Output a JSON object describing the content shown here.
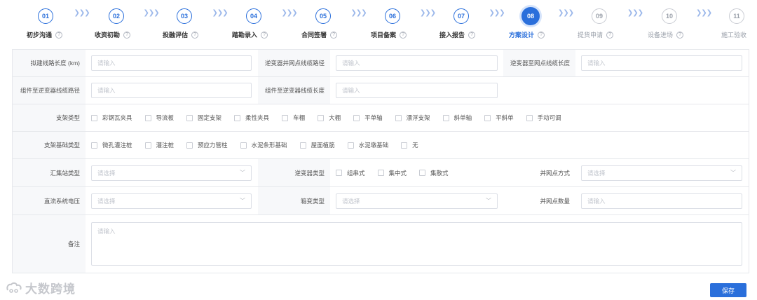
{
  "stepper": {
    "steps": [
      {
        "num": "01",
        "label": "初步沟通"
      },
      {
        "num": "02",
        "label": "收资初勘"
      },
      {
        "num": "03",
        "label": "投融评估"
      },
      {
        "num": "04",
        "label": "踏勘录入"
      },
      {
        "num": "05",
        "label": "合同签署"
      },
      {
        "num": "06",
        "label": "项目备案"
      },
      {
        "num": "07",
        "label": "接入报告"
      },
      {
        "num": "08",
        "label": "方案设计"
      },
      {
        "num": "09",
        "label": "提货申请"
      },
      {
        "num": "10",
        "label": "设备进场"
      },
      {
        "num": "11",
        "label": "施工验收"
      }
    ],
    "active_index": 7,
    "separator": "❯❯❯",
    "help_glyph": "?"
  },
  "form": {
    "line_length_label": "拟建线路长度 (km)",
    "line_length_placeholder": "请输入",
    "inverter_grid_route_label": "逆变器并网点线缆路径",
    "inverter_grid_route_placeholder": "请输入",
    "inverter_grid_length_label": "逆变器至网点线缆长度",
    "inverter_grid_length_placeholder": "请输入",
    "module_inverter_route_label": "组件至逆变器线缆路径",
    "module_inverter_route_placeholder": "请输入",
    "module_inverter_length_label": "组件至逆变器线缆长度",
    "module_inverter_length_placeholder": "请输入",
    "bracket_type_label": "支架类型",
    "bracket_type_options": [
      "彩钢瓦夹具",
      "导流板",
      "固定支架",
      "柔性夹具",
      "车棚",
      "大棚",
      "平单轴",
      "漂浮支架",
      "斜单轴",
      "平斜单",
      "手动可调"
    ],
    "bracket_foundation_label": "支架基础类型",
    "bracket_foundation_options": [
      "微孔灌注桩",
      "灌注桩",
      "预应力管柱",
      "水泥条形基础",
      "屋面植筋",
      "水泥墩基础",
      "无"
    ],
    "collector_type_label": "汇集站类型",
    "collector_type_placeholder": "请选择",
    "inverter_type_label": "逆变器类型",
    "inverter_type_options": [
      "组串式",
      "集中式",
      "集散式"
    ],
    "grid_method_label": "并网点方式",
    "grid_method_placeholder": "请选择",
    "dc_voltage_label": "直流系统电压",
    "dc_voltage_placeholder": "请选择",
    "transformer_type_label": "箱变类型",
    "transformer_type_placeholder": "请选择",
    "grid_count_label": "并网点数量",
    "grid_count_placeholder": "请输入",
    "remark_label": "备注",
    "remark_placeholder": "请输入"
  },
  "footer": {
    "watermark_text": "大数跨境",
    "save_label": "保存"
  },
  "colors": {
    "accent": "#2a6fdb",
    "label_bg": "#f7f8fa",
    "border": "#e6e8ec"
  }
}
